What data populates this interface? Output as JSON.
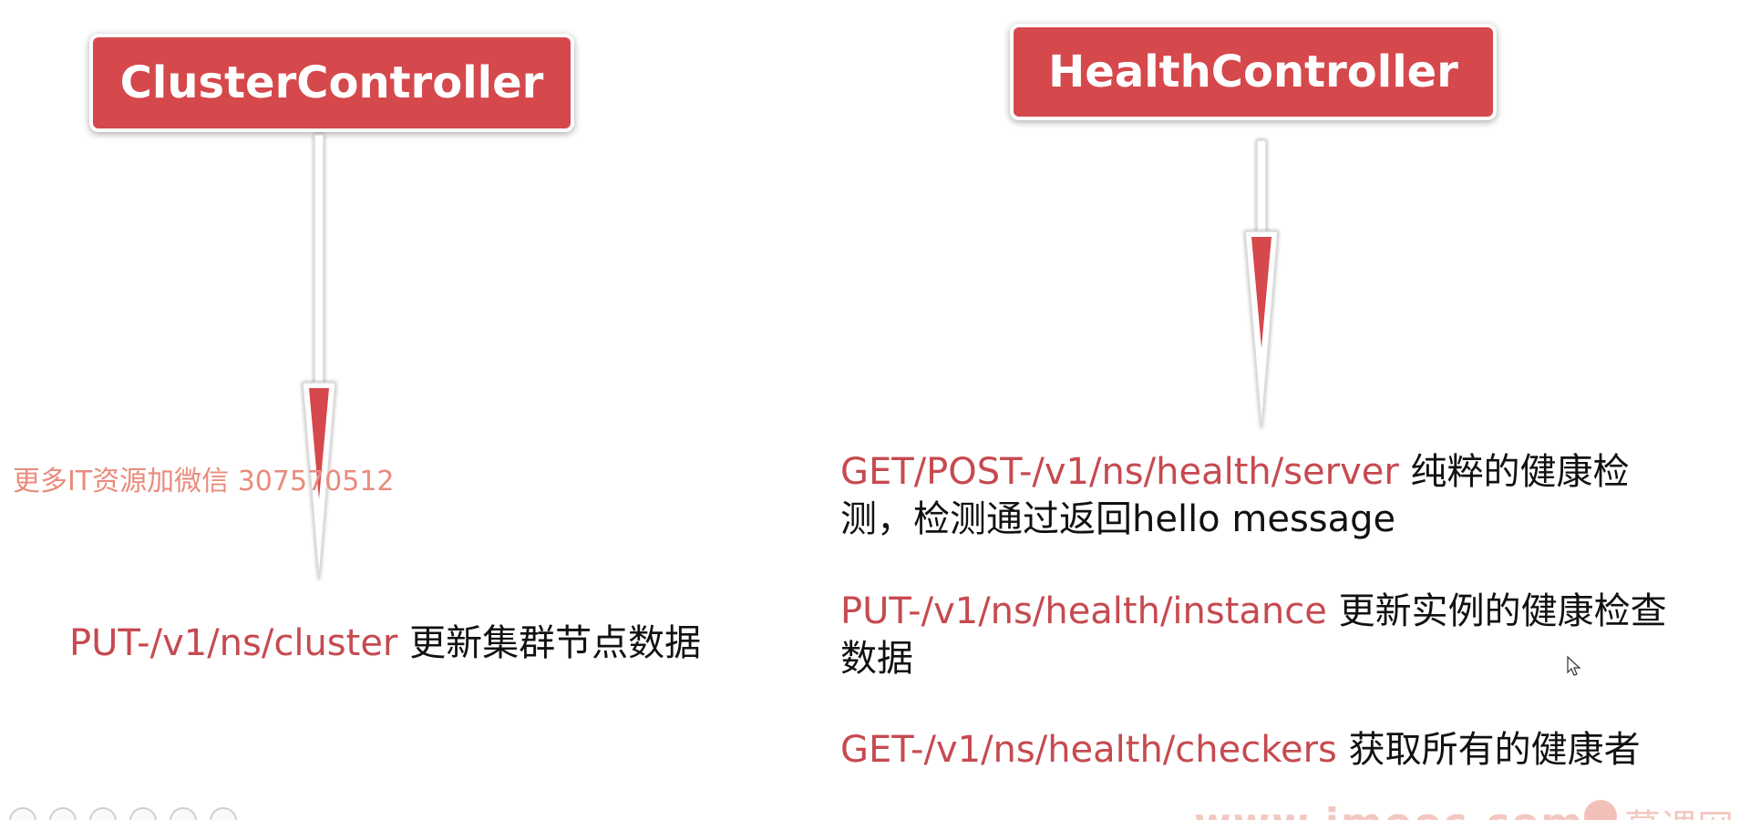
{
  "nodes": {
    "cluster_controller": "ClusterController",
    "health_controller": "HealthController"
  },
  "watermark": "更多IT资源加微信 307570512",
  "endpoints": {
    "cluster": {
      "path": "PUT-/v1/ns/cluster",
      "description": " 更新集群节点数据"
    },
    "health_server": {
      "path": "GET/POST-/v1/ns/health/server",
      "description": " 纯粹的健康检测，检测通过返回hello message"
    },
    "health_instance": {
      "path": "PUT-/v1/ns/health/instance",
      "description": " 更新实例的健康检查数据"
    },
    "health_checkers": {
      "path": "GET-/v1/ns/health/checkers",
      "description": " 获取所有的健康者"
    }
  },
  "footer": {
    "site": "www.imooc.com",
    "brand": "慕课网"
  },
  "colors": {
    "box": "#d5484c",
    "path_text": "#c64a50",
    "watermark": "#e98b7d"
  },
  "icons": [
    "toolbar-tool-icon",
    "cursor-icon",
    "brand-logo-icon",
    "arrow-down-icon"
  ]
}
